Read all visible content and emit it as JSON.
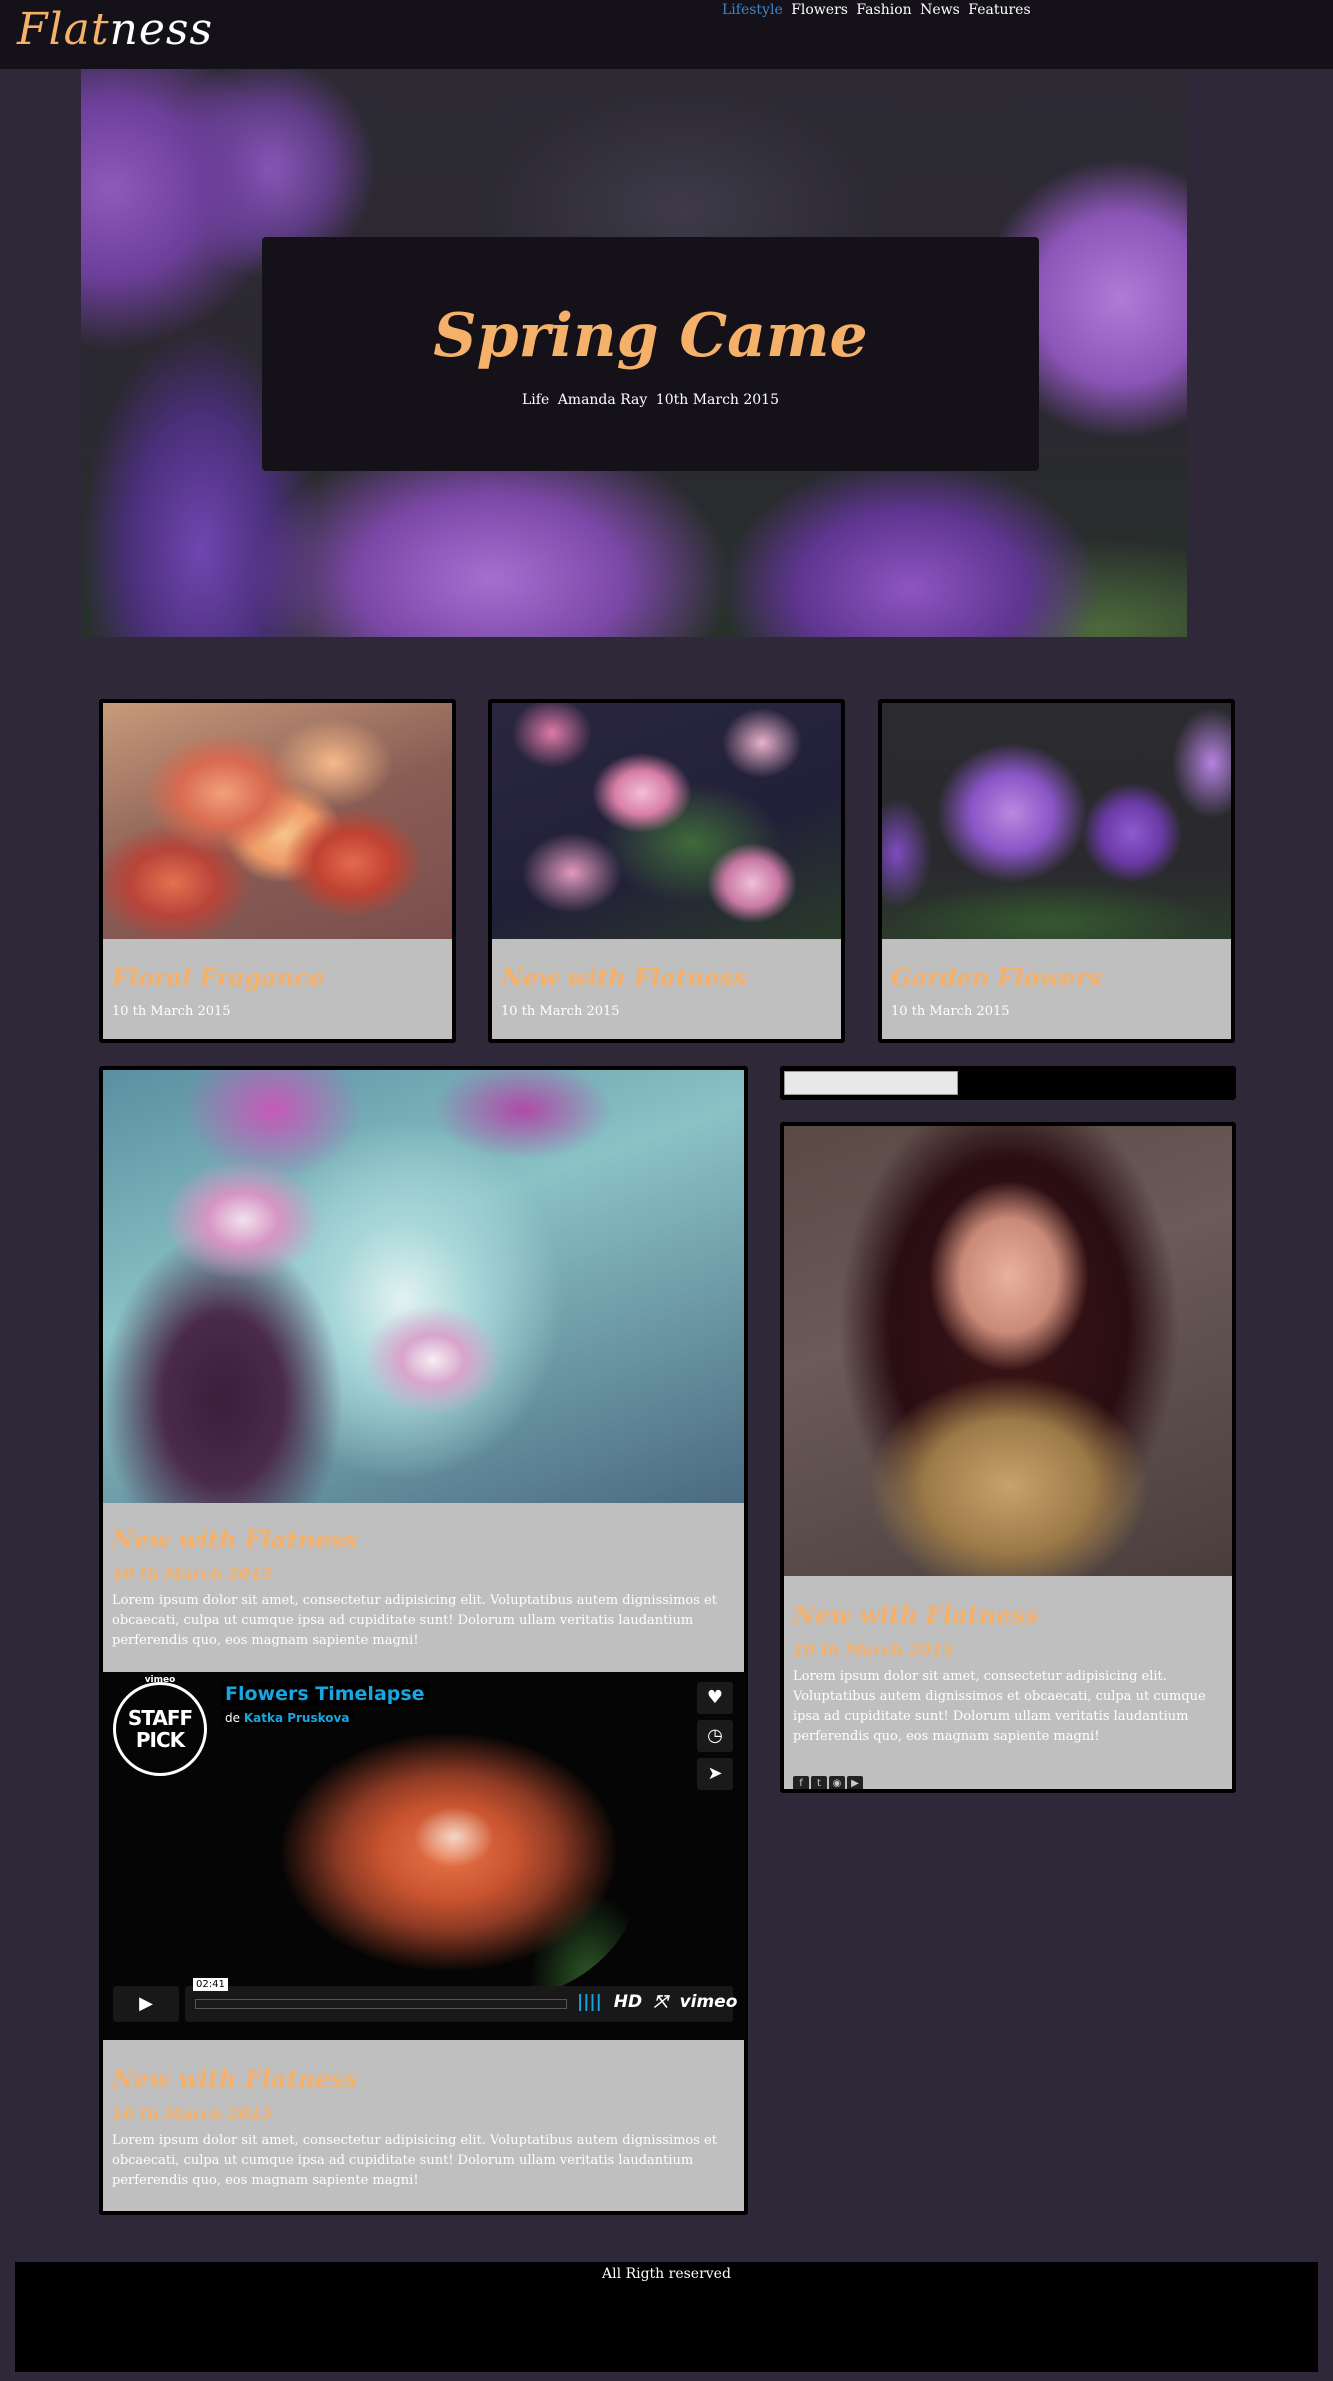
{
  "header": {
    "logo_main": "Flat",
    "logo_rest": "ness",
    "nav": [
      "Lifestyle",
      "Flowers",
      "Fashion",
      "News",
      "Features"
    ]
  },
  "hero": {
    "title": "Spring Came",
    "category": "Life",
    "author": "Amanda Ray",
    "date": "10th March 2015"
  },
  "cards": [
    {
      "title": "Floral Fragance",
      "date": "10 th March 2015"
    },
    {
      "title": "New with Flatness",
      "date": "10 th March 2015"
    },
    {
      "title": "Garden Flowers",
      "date": "10 th March 2015"
    }
  ],
  "main_post": {
    "title": "New with Flatness",
    "date": "10 th March 2015",
    "text": "Lorem ipsum dolor sit amet, consectetur adipisicing elit. Voluptatibus autem dignissimos et obcaecati, culpa ut cumque ipsa ad cupiditate sunt! Dolorum ullam veritatis laudantium perferendis quo, eos magnam sapiente magni!"
  },
  "video": {
    "staff_vimeo": "vimeo",
    "staff_pick": "STAFF PICK",
    "title": "Flowers Timelapse",
    "by_prefix": "de",
    "author": "Katka Pruskova",
    "time": "02:41",
    "hd": "HD",
    "brand": "vimeo"
  },
  "video_post": {
    "title": "New with Flatness",
    "date": "10 th March 2015",
    "text": "Lorem ipsum dolor sit amet, consectetur adipisicing elit. Voluptatibus autem dignissimos et obcaecati, culpa ut cumque ipsa ad cupiditate sunt! Dolorum ullam veritatis laudantium perferendis quo, eos magnam sapiente magni!"
  },
  "sidebar": {
    "search_value": "",
    "post": {
      "title": "New with Flatness",
      "date": "10 th March 2015",
      "text": "Lorem ipsum dolor sit amet, consectetur adipisicing elit. Voluptatibus autem dignissimos et obcaecati, culpa ut cumque ipsa ad cupiditate sunt! Dolorum ullam veritatis laudantium perferendis quo, eos magnam sapiente magni!"
    },
    "social_icons": [
      "facebook-icon",
      "twitter-icon",
      "instagram-icon",
      "youtube-icon"
    ]
  },
  "footer": {
    "text": "All Rigth reserved"
  },
  "colors": {
    "accent": "#f5b06a",
    "nav_active": "#3d84c6",
    "vimeo_blue": "#19a6e0",
    "background": "#2e2838"
  }
}
